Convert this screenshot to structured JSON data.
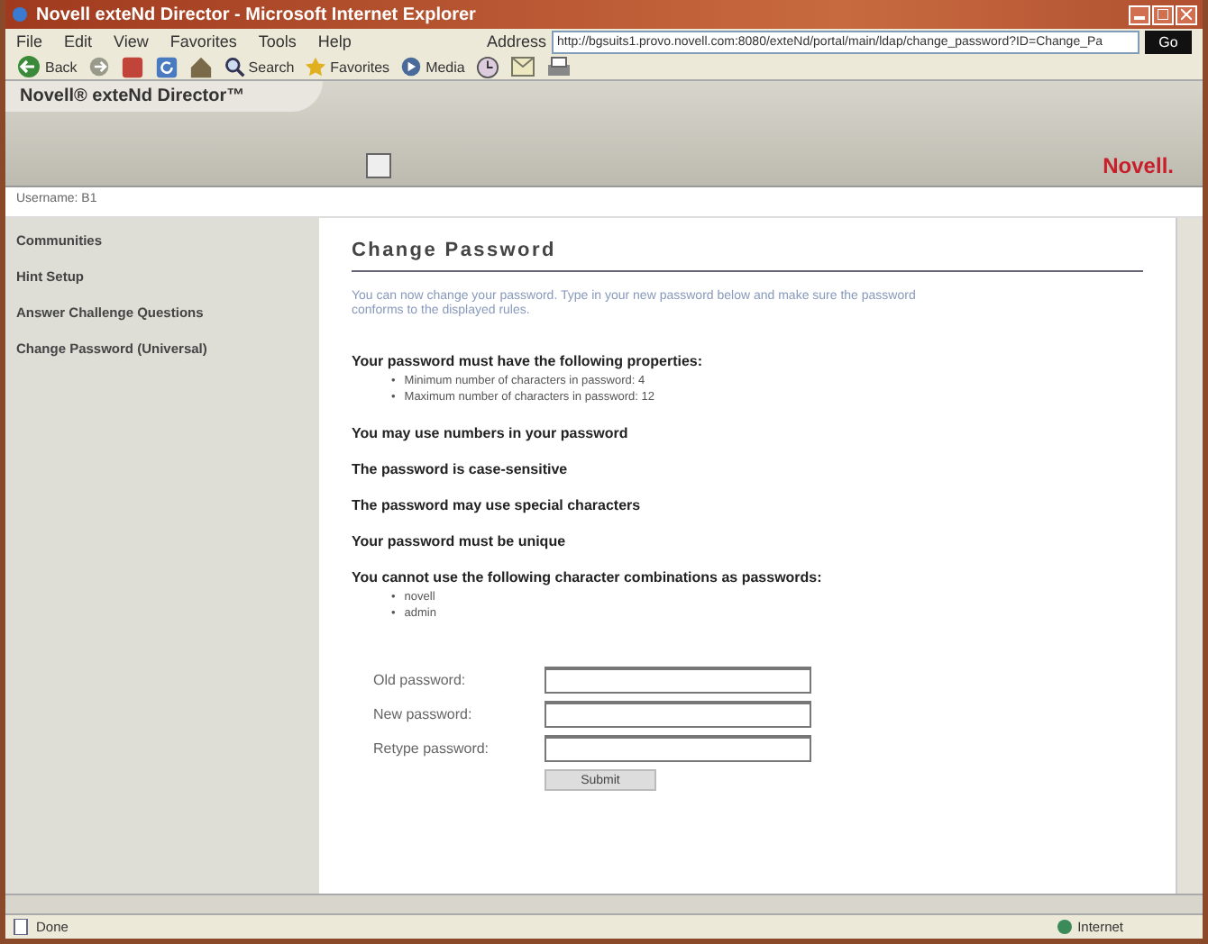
{
  "window": {
    "title": "Novell exteNd Director - Microsoft Internet Explorer"
  },
  "menu": [
    "File",
    "Edit",
    "View",
    "Favorites",
    "Tools",
    "Help"
  ],
  "address": {
    "label": "Address",
    "value": "http://bgsuits1.provo.novell.com:8080/exteNd/portal/main/ldap/change_password?ID=Change_Pa",
    "go": "Go"
  },
  "toolbar": [
    {
      "kind": "back",
      "label": "Back"
    },
    {
      "kind": "forward"
    },
    {
      "kind": "stop"
    },
    {
      "kind": "refresh"
    },
    {
      "kind": "home"
    },
    {
      "kind": "search",
      "label": "Search"
    },
    {
      "kind": "favorites",
      "label": "Favorites"
    },
    {
      "kind": "media",
      "label": "Media"
    },
    {
      "kind": "history"
    },
    {
      "kind": "mail"
    },
    {
      "kind": "print"
    }
  ],
  "banner": {
    "product": "Novell® exteNd Director™",
    "brand": "Novell."
  },
  "user": "Username: B1",
  "sidebar": {
    "items": [
      {
        "label": "Communities"
      },
      {
        "label": "Hint Setup"
      },
      {
        "label": "Answer Challenge Questions"
      },
      {
        "label": "Change Password (Universal)"
      }
    ]
  },
  "content": {
    "heading": "Change Password",
    "intro": "You can now change your password. Type in your new password below and make sure the password conforms to the displayed rules.",
    "rules": [
      {
        "text": "Your password must have the following properties:",
        "items": [
          {
            "bullet": "•",
            "text": "Minimum number of characters in password: 4"
          },
          {
            "bullet": "•",
            "text": "Maximum number of characters in password: 12"
          }
        ]
      },
      {
        "text": "You may use numbers in your password"
      },
      {
        "text": "The password is case-sensitive"
      },
      {
        "text": "The password may use special characters"
      },
      {
        "text": "Your password must be unique"
      },
      {
        "text": "You cannot use the following character combinations as passwords:",
        "items": [
          {
            "bullet": "•",
            "text": "novell"
          },
          {
            "bullet": "•",
            "text": "admin"
          }
        ]
      }
    ],
    "fields": [
      {
        "label": "Old password:"
      },
      {
        "label": "New password:"
      },
      {
        "label": "Retype password:"
      }
    ],
    "submit": "Submit"
  },
  "status_bar": {
    "text": "Done",
    "zone": "Internet"
  }
}
